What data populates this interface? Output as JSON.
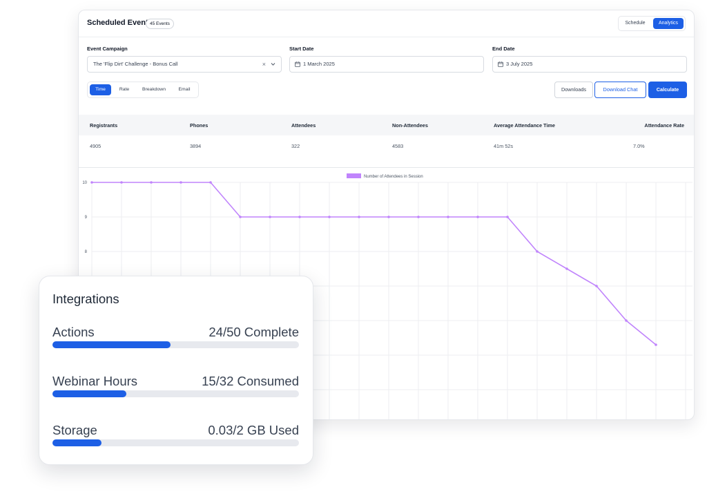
{
  "header": {
    "title": "Scheduled Events",
    "event_count": "45 Events",
    "views": [
      "Schedule",
      "Analytics"
    ],
    "active_view": "Analytics"
  },
  "filters": {
    "campaign_label": "Event Campaign",
    "campaign_value": "The 'Flip Dirt' Challenge - Bonus Call",
    "start_label": "Start Date",
    "start_value": "1 March 2025",
    "end_label": "End Date",
    "end_value": "3 July 2025"
  },
  "tabs": {
    "items": [
      "Time",
      "Rate",
      "Breakdown",
      "Email"
    ],
    "active": "Time"
  },
  "actions": {
    "downloads": "Downloads",
    "download_chat": "Download Chat",
    "calculate": "Calculate"
  },
  "stats": {
    "columns": [
      "Registrants",
      "Phones",
      "Attendees",
      "Non-Attendees",
      "Average Attendance Time",
      "Attendance Rate"
    ],
    "values": [
      "4905",
      "3894",
      "322",
      "4583",
      "41m 52s",
      "7.0%"
    ]
  },
  "chart_data": {
    "type": "line",
    "series": [
      {
        "name": "Number of Attendees in Session",
        "values": [
          10,
          10,
          10,
          10,
          10,
          9,
          9,
          9,
          9,
          9,
          9,
          9,
          9,
          9,
          9,
          8,
          7.5,
          7,
          6,
          5.3
        ]
      }
    ],
    "ylim": [
      5.3,
      10
    ],
    "yticks_visible": [
      "10",
      "9",
      "8"
    ],
    "grid": true,
    "legend_position": "top-center",
    "color": "#c084fc"
  },
  "integrations": {
    "title": "Integrations",
    "items": [
      {
        "label": "Actions",
        "value": "24/50 Complete",
        "fraction": 0.48
      },
      {
        "label": "Webinar Hours",
        "value": "15/32 Consumed",
        "fraction": 0.3
      },
      {
        "label": "Storage",
        "value": "0.03/2 GB Used",
        "fraction": 0.2
      }
    ],
    "bar_color": "#1d5fe5",
    "track_color": "#e7e9ee"
  }
}
